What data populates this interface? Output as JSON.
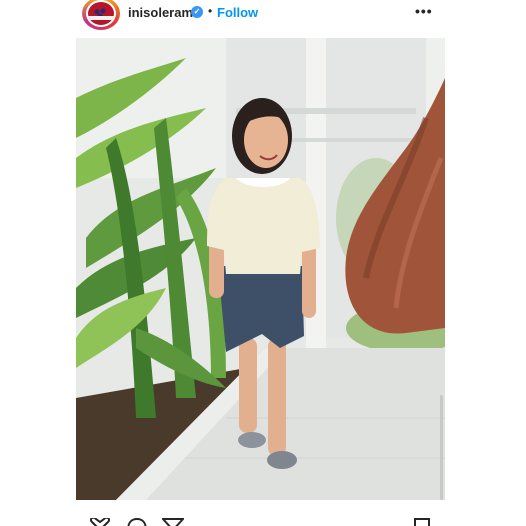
{
  "post": {
    "username": "inisoleram",
    "verified_icon": "verified-badge-icon",
    "separator": "•",
    "follow_label": "Follow",
    "more_label": "•••",
    "image_description_icon": "photo",
    "actions": {
      "like": "heart-icon",
      "comment": "comment-icon",
      "share": "share-icon",
      "save": "bookmark-icon"
    }
  },
  "colors": {
    "follow_blue": "#0095f6",
    "verified_blue": "#3897f0",
    "text": "#262626"
  }
}
